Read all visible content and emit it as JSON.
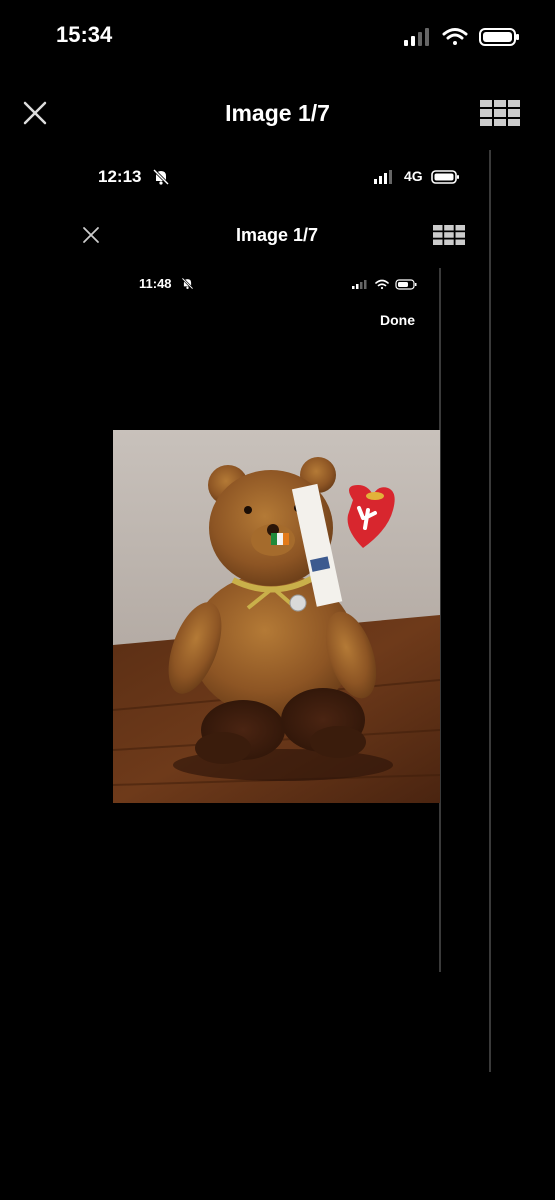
{
  "outer": {
    "status_time": "15:34",
    "title": "Image 1/7"
  },
  "level1": {
    "status_time": "12:13",
    "network": "4G",
    "title": "Image 1/7"
  },
  "level2": {
    "status_time": "11:48",
    "done_label": "Done"
  },
  "icons": {
    "close": "close-icon",
    "grid": "grid-icon",
    "bell_muted": "bell-slash-icon",
    "signal": "signal-icon",
    "wifi": "wifi-icon",
    "battery": "battery-icon"
  },
  "colors": {
    "background": "#000000",
    "text": "#ffffff",
    "scroll_track": "#3a3a3a",
    "tag_red": "#d8262e"
  }
}
